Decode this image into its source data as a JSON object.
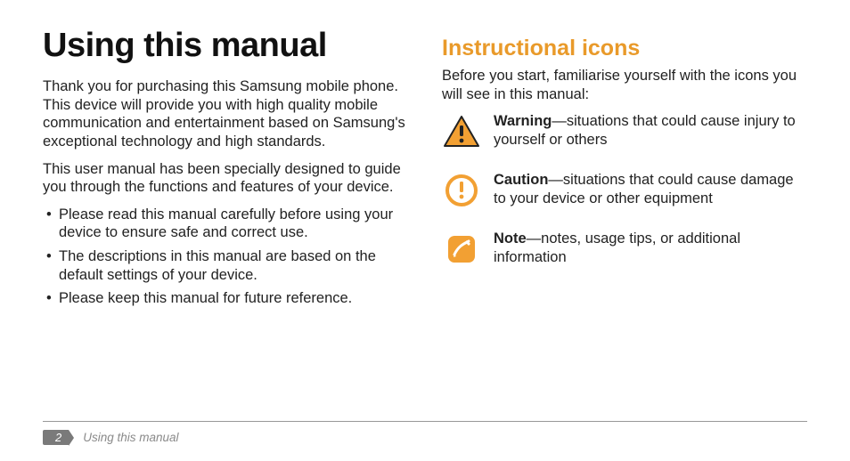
{
  "left": {
    "title": "Using this manual",
    "intro1": "Thank you for purchasing this Samsung mobile phone. This device will provide you with high quality mobile communication and entertainment based on Samsung's exceptional technology and high standards.",
    "intro2": "This user manual has been specially designed to guide you through the functions and features of your device.",
    "bullets": [
      "Please read this manual carefully before using your device to ensure safe and correct use.",
      "The descriptions in this manual are based on the default settings of your device.",
      "Please keep this manual for future reference."
    ]
  },
  "right": {
    "section_title": "Instructional icons",
    "intro": "Before you start, familiarise yourself with the icons you will see in this manual:",
    "items": [
      {
        "label": "Warning",
        "desc": "—situations that could cause injury to yourself or others",
        "icon": "warning-icon"
      },
      {
        "label": "Caution",
        "desc": "—situations that could cause damage to your device or other equipment",
        "icon": "caution-icon"
      },
      {
        "label": "Note",
        "desc": "—notes, usage tips, or additional information",
        "icon": "note-icon"
      }
    ]
  },
  "footer": {
    "page_number": "2",
    "label": "Using this manual"
  },
  "colors": {
    "accent": "#e99a2a"
  }
}
